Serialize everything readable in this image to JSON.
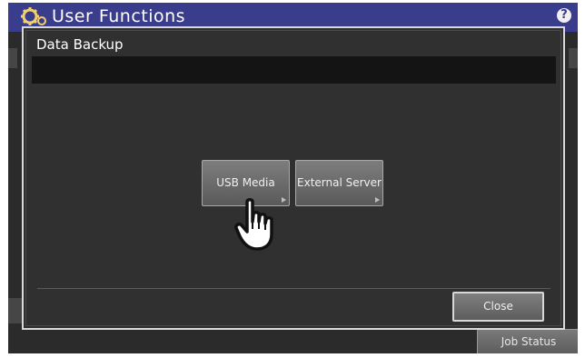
{
  "header": {
    "title": "User Functions",
    "help_label": "?"
  },
  "dialog": {
    "title": "Data Backup",
    "options": [
      {
        "label": "USB Media"
      },
      {
        "label": "External Server"
      }
    ],
    "close_label": "Close"
  },
  "background": {
    "job_status_label": "Job Status"
  },
  "icons": {
    "header": "gear-icon",
    "help": "help-icon",
    "pointer": "hand-pointer-icon"
  }
}
